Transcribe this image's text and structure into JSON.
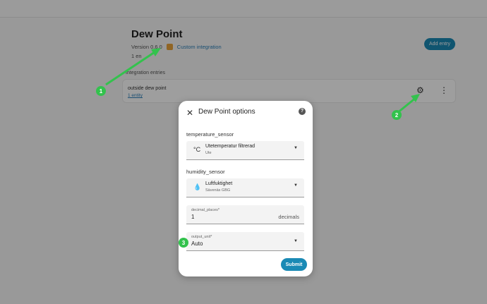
{
  "integration": {
    "title": "Dew Point",
    "version": "Version 0.6.0",
    "custom_label": "Custom integration",
    "entries_count": "1 en",
    "add_entry_label": "Add entry",
    "entries_section_label": "Integration entries",
    "entry": {
      "name": "outside dew point",
      "link": "1 entity"
    }
  },
  "dialog": {
    "title": "Dew Point options",
    "help_glyph": "?",
    "temperature": {
      "label": "temperature_sensor",
      "icon": "°C",
      "name": "Utetemperatur filtrerad",
      "area": "Ute"
    },
    "humidity": {
      "label": "humidity_sensor",
      "icon": "💧",
      "name": "Luftfuktighet",
      "area": "Sävenäs GBG"
    },
    "decimal_places": {
      "label": "decimal_places*",
      "value": "1",
      "suffix": "decimals"
    },
    "output_unit": {
      "label": "output_unit*",
      "value": "Auto"
    },
    "submit_label": "Submit"
  },
  "callouts": [
    "1",
    "2",
    "3"
  ],
  "colors": {
    "accent": "#1a8ab5",
    "callout": "#33c24d"
  }
}
